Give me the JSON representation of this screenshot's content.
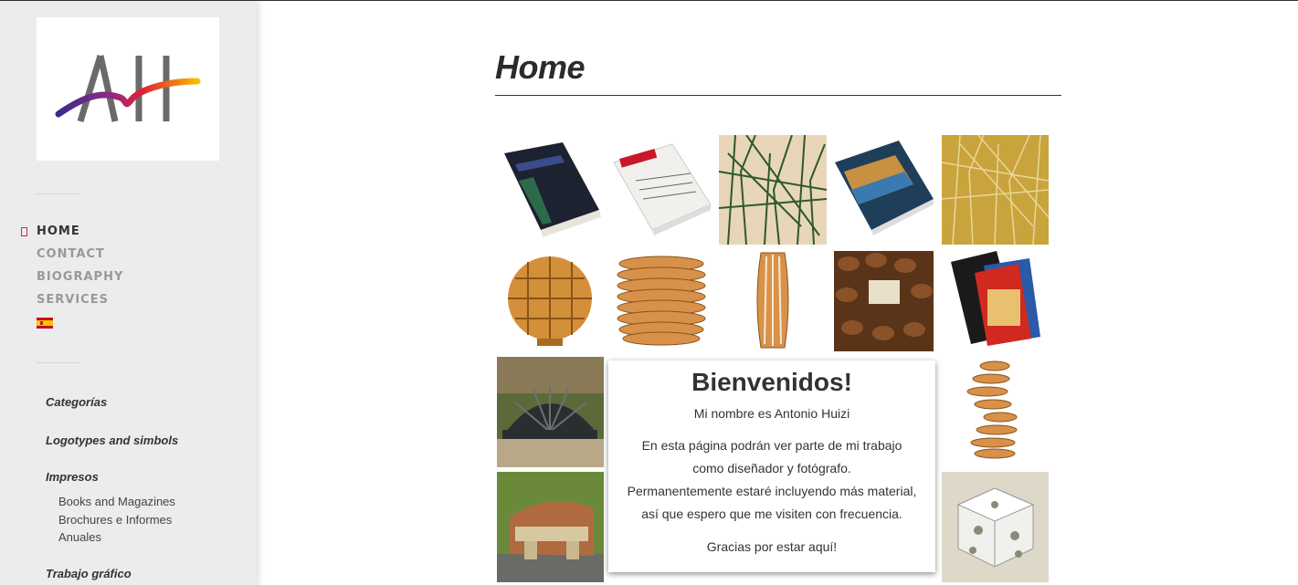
{
  "page": {
    "title": "Home"
  },
  "sidebar": {
    "logo_alt": "AH",
    "nav": [
      {
        "label": "HOME",
        "active": true
      },
      {
        "label": "CONTACT",
        "active": false
      },
      {
        "label": "BIOGRAPHY",
        "active": false
      },
      {
        "label": "SERVICES",
        "active": false
      }
    ],
    "language_flag": "spain-flag-icon",
    "categories_heading": "Categorías",
    "cat_logotypes": "Logotypes and simbols",
    "cat_impresos": "Impresos",
    "sub_books": "Books and Magazines",
    "sub_brochures_1": "Brochures e Informes",
    "sub_brochures_2": "Anuales",
    "cat_trabajo": "Trabajo gráfico"
  },
  "welcome": {
    "heading": "Bienvenidos!",
    "name_line": "Mi nombre es Antonio Huizi",
    "line1": "En esta página podrán ver parte de mi trabajo",
    "line2": "como diseñador y fotógrafo.",
    "line3": "Permanentemente estaré incluyendo más material,",
    "line4": "así que espero que me visiten con frecuencia.",
    "thanks": "Gracias por estar aquí!"
  },
  "colors": {
    "accent": "#c0304a",
    "sidebar_bg": "#ececec"
  }
}
